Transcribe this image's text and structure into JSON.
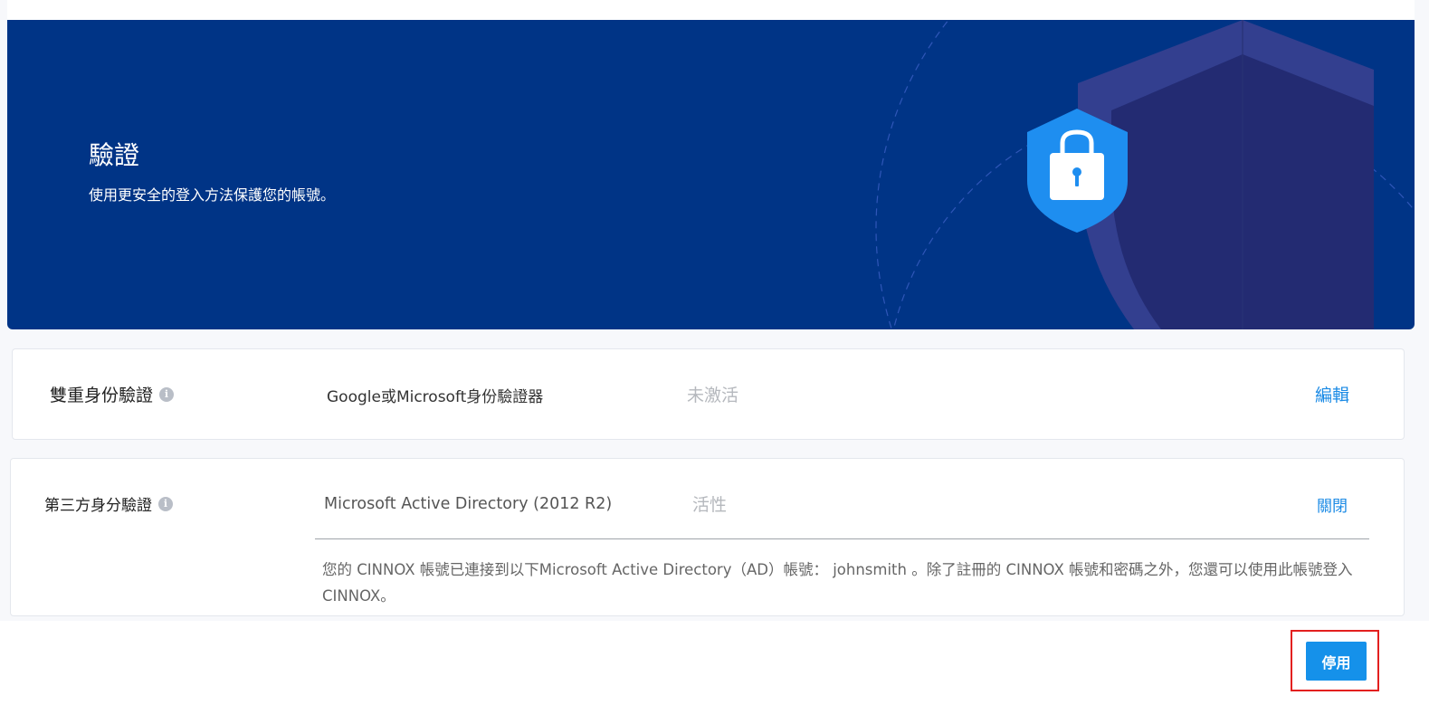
{
  "banner": {
    "title": "驗證",
    "subtitle": "使用更安全的登入方法保護您的帳號。",
    "background_color": "#003486",
    "illustration": "shield-lock-icon"
  },
  "two_factor": {
    "label": "雙重身份驗證",
    "info_icon": "i",
    "method": "Google或Microsoft身份驗證器",
    "status": "未激活",
    "action": "編輯"
  },
  "third_party": {
    "label": "第三方身分驗證",
    "info_icon": "i",
    "method": "Microsoft Active Directory (2012 R2)",
    "status": "活性",
    "action": "關閉",
    "description": "您的 CINNOX 帳號已連接到以下Microsoft Active Directory（AD）帳號： johnsmith 。除了註冊的 CINNOX 帳號和密碼之外，您還可以使用此帳號登入 CINNOX。"
  },
  "footer": {
    "disable_button": "停用"
  },
  "colors": {
    "accent": "#1591ea",
    "link": "#1a8ae5",
    "highlight": "#e3201f"
  }
}
